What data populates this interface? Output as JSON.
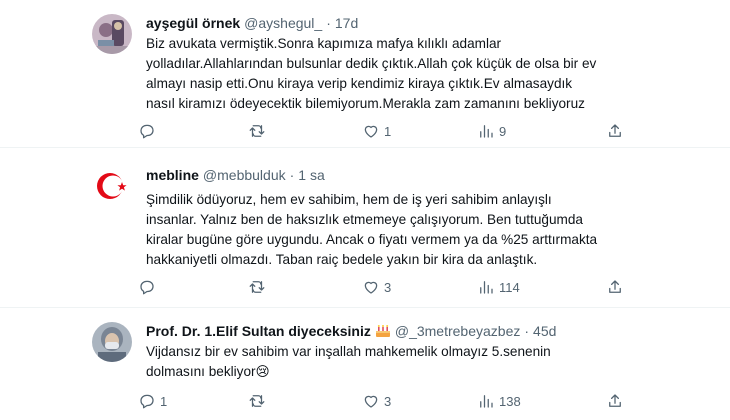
{
  "tweets": [
    {
      "name": "ayşegül örnek",
      "handle": "@ayshegul_",
      "separator": "·",
      "time": "17d",
      "text": "Biz avukata vermiştik.Sonra kapımıza mafya kılıklı adamlar\nyolladılar.Allahlarından bulsunlar dedik çıktık.Allah çok küçük de olsa bir ev\nalmayı nasip etti.Onu kiraya verip kendimiz kiraya çıktık.Ev almasaydık\nnasıl kiramızı ödeyecektik bilemiyorum.Merakla zam zamanını bekliyoruz",
      "replies": "",
      "retweets": "",
      "likes": "1",
      "views": "9"
    },
    {
      "name": "mebline",
      "handle": "@mebbulduk",
      "separator": "·",
      "time": "1 sa",
      "text": "Şimdilik ödüyoruz, hem ev sahibim, hem de iş yeri sahibim anlayışlı\ninsanlar. Yalnız ben de haksızlık etmemeye çalışıyorum. Ben tuttuğumda\nkiralar bugüne göre uygundu. Ancak o fiyatı vermem ya da %25 arttırmakta\nhakkaniyetli olmazdı. Taban raiç bedele yakın bir kira da anlaştık.",
      "replies": "",
      "retweets": "",
      "likes": "3",
      "views": "114"
    },
    {
      "name": "Prof. Dr. 1.Elif Sultan diyeceksiniz",
      "handle": "@_3metrebeyazbez",
      "separator": "·",
      "time": "45d",
      "text": "Vijdansız bir ev sahibim var inşallah mahkemelik olmayız 5.senenin\ndolmasını bekliyor😢",
      "replies": "1",
      "retweets": "",
      "likes": "3",
      "views": "138"
    }
  ],
  "icons": {
    "reply": "reply-icon",
    "retweet": "retweet-icon",
    "like": "heart-icon",
    "views": "views-chart-icon",
    "share": "share-icon",
    "badge": "birthday-cake-icon"
  },
  "colors": {
    "text": "#0f1419",
    "muted": "#536471",
    "divider": "#eff3f4",
    "turkey_red": "#e30a17"
  }
}
